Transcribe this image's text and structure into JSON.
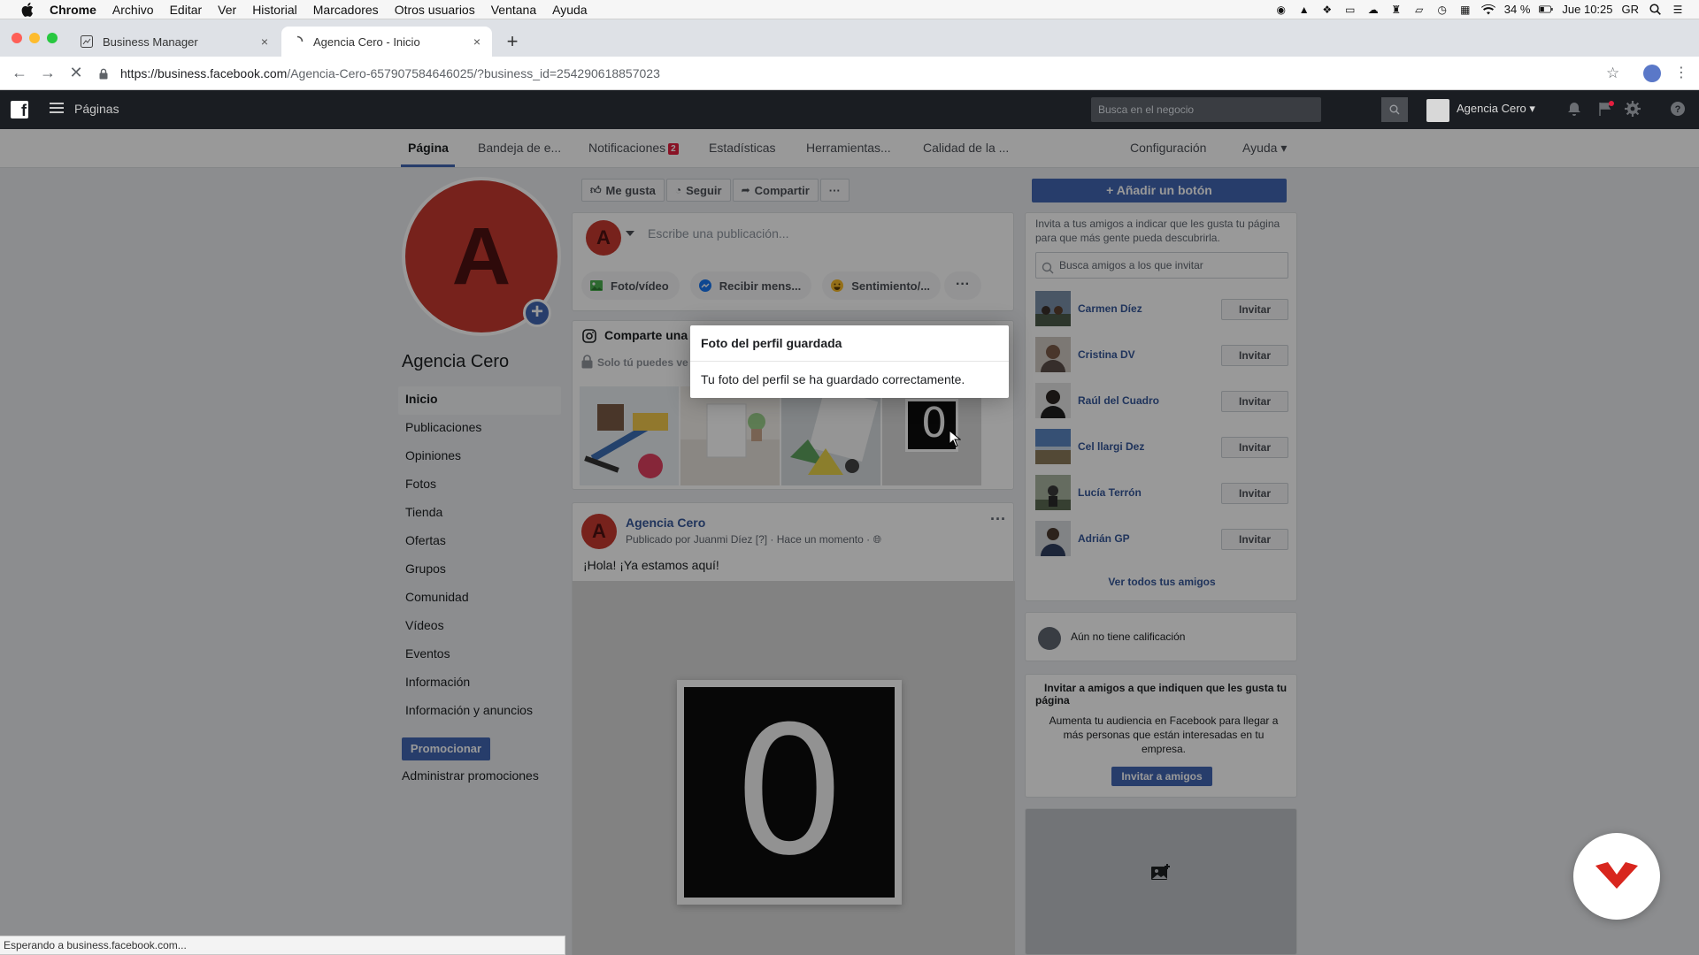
{
  "mac_menu": {
    "app": "Chrome",
    "items": [
      "Archivo",
      "Editar",
      "Ver",
      "Historial",
      "Marcadores",
      "Otros usuarios",
      "Ventana",
      "Ayuda"
    ],
    "battery": "34 %",
    "clock": "Jue 10:25",
    "user": "GR"
  },
  "tabs": [
    {
      "title": "Business Manager",
      "close": "×"
    },
    {
      "title": "Agencia Cero - Inicio",
      "close": "×"
    }
  ],
  "address_bar": {
    "host": "https://business.facebook.com",
    "path": "/Agencia-Cero-657907584646025/?business_id=254290618857023"
  },
  "fb_topbar": {
    "section": "Páginas",
    "search_placeholder": "Busca en el negocio",
    "business_name": "Agencia Cero"
  },
  "page_nav": {
    "items": [
      {
        "label": "Página"
      },
      {
        "label": "Bandeja de e..."
      },
      {
        "label": "Notificaciones",
        "badge": "2"
      },
      {
        "label": "Estadísticas"
      },
      {
        "label": "Herramientas..."
      },
      {
        "label": "Calidad de la ..."
      }
    ],
    "config": "Configuración",
    "help": "Ayuda ▾"
  },
  "left": {
    "avatar_letter": "A",
    "page_name": "Agencia Cero",
    "menu": [
      "Inicio",
      "Publicaciones",
      "Opiniones",
      "Fotos",
      "Tienda",
      "Ofertas",
      "Grupos",
      "Comunidad",
      "Vídeos",
      "Eventos",
      "Información",
      "Información y anuncios"
    ],
    "promote": "Promocionar",
    "manage_promos": "Administrar promociones"
  },
  "actions": {
    "like": "Me gusta",
    "follow": "Seguir",
    "share": "Compartir",
    "more": "···"
  },
  "composer": {
    "placeholder": "Escribe una publicación...",
    "chips": [
      "Foto/vídeo",
      "Recibir mens...",
      "Sentimiento/..."
    ],
    "more": "···"
  },
  "instagram": {
    "title": "Comparte una f",
    "subtitle": "Solo tú puedes ve",
    "thumb_digit": "0"
  },
  "post": {
    "author": "Agencia Cero",
    "meta": "Publicado por Juanmi Díez [?] · Hace un momento ·",
    "text": "¡Hola! ¡Ya estamos aquí!",
    "image_digit": "0",
    "menu": "···"
  },
  "right": {
    "add_button": "+ Añadir un botón",
    "invite_desc": "Invita a tus amigos a indicar que les gusta tu página para que más gente pueda descubrirla.",
    "search_placeholder": "Busca amigos a los que invitar",
    "invite_label": "Invitar",
    "friends": [
      "Carmen Díez",
      "Cristina DV",
      "Raúl del Cuadro",
      "Cel llargi Dez",
      "Lucía Terrón",
      "Adrián GP"
    ],
    "see_all": "Ver todos tus amigos",
    "rating": "Aún no tiene calificación",
    "invite2_title": "Invitar a amigos a que indiquen que les gusta tu página",
    "invite2_desc": "Aumenta tu audiencia en Facebook para llegar a más personas que están interesadas en tu empresa.",
    "invite2_button": "Invitar a amigos"
  },
  "dialog": {
    "title": "Foto del perfil guardada",
    "body": "Tu foto del perfil se ha guardado correctamente."
  },
  "status_bar": "Esperando a business.facebook.com...",
  "colors": {
    "fb_blue": "#4267b2",
    "link_blue": "#365899",
    "avatar_red": "#c6392f",
    "brand_red": "#d8261e"
  }
}
